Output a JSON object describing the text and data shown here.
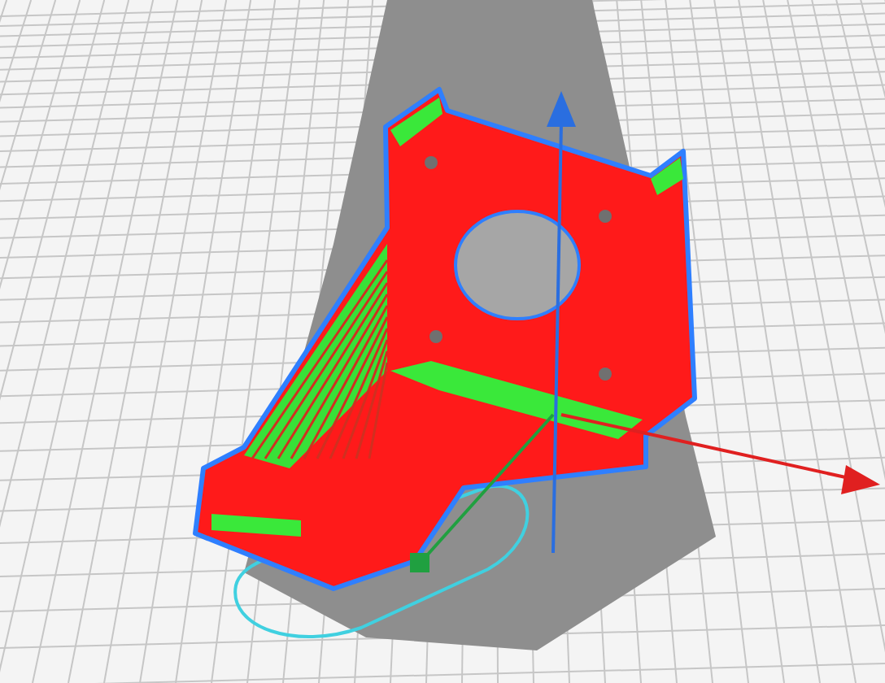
{
  "viewport": {
    "kind": "perspective",
    "axes": [
      {
        "kind": "x",
        "color": "#e02020"
      },
      {
        "kind": "y",
        "color": "#20a040"
      },
      {
        "kind": "z",
        "color": "#2a6ee0"
      }
    ]
  }
}
